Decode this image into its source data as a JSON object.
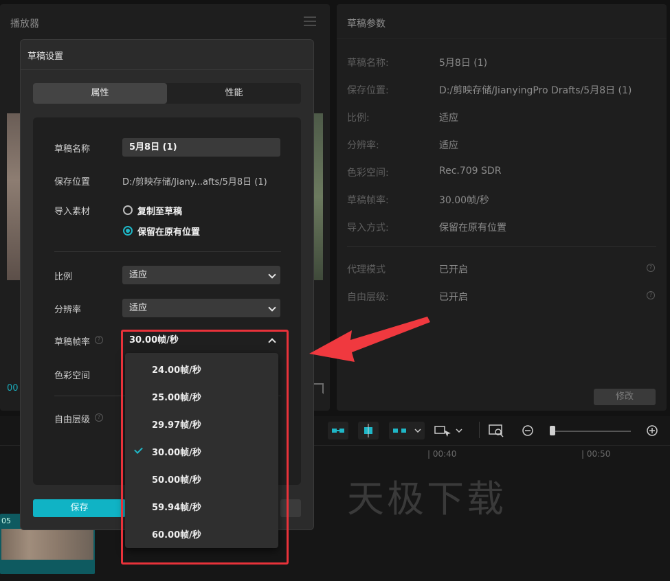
{
  "player": {
    "title": "播放器",
    "time_code": "00"
  },
  "params": {
    "title": "草稿参数",
    "rows": [
      {
        "key": "草稿名称:",
        "value": "5月8日 (1)"
      },
      {
        "key": "保存位置:",
        "value": "D:/剪映存储/JianyingPro Drafts/5月8日 (1)"
      },
      {
        "key": "比例:",
        "value": "适应"
      },
      {
        "key": "分辨率:",
        "value": "适应"
      },
      {
        "key": "色彩空间:",
        "value": "Rec.709 SDR"
      },
      {
        "key": "草稿帧率:",
        "value": "30.00帧/秒"
      },
      {
        "key": "导入方式:",
        "value": "保留在原有位置"
      },
      {
        "key": "代理模式",
        "value": "已开启"
      },
      {
        "key": "自由层级:",
        "value": "已开启"
      }
    ],
    "edit_label": "修改"
  },
  "timeline": {
    "ticks": [
      "| 00:40",
      "| 00:50"
    ],
    "clip_label": "05",
    "watermark": "天极下载"
  },
  "modal": {
    "title": "草稿设置",
    "tabs": {
      "attributes": "属性",
      "performance": "性能"
    },
    "name_label": "草稿名称",
    "name_value": "5月8日 (1)",
    "save_path_label": "保存位置",
    "save_path_value": "D:/剪映存储/Jiany...afts/5月8日 (1)",
    "import_label": "导入素材",
    "import_options": [
      "复制至草稿",
      "保留在原有位置"
    ],
    "ratio_label": "比例",
    "ratio_value": "适应",
    "resolution_label": "分辨率",
    "resolution_value": "适应",
    "framerate_label": "草稿帧率",
    "framerate_value": "30.00帧/秒",
    "colorspace_label": "色彩空间",
    "free_layer_label": "自由层级",
    "save_label": "保存"
  },
  "framerate_options": [
    "24.00帧/秒",
    "25.00帧/秒",
    "29.97帧/秒",
    "30.00帧/秒",
    "50.00帧/秒",
    "59.94帧/秒",
    "60.00帧/秒"
  ],
  "framerate_selected": "30.00帧/秒",
  "colors": {
    "accent": "#1fb7c7",
    "annotation": "#e8323a"
  }
}
